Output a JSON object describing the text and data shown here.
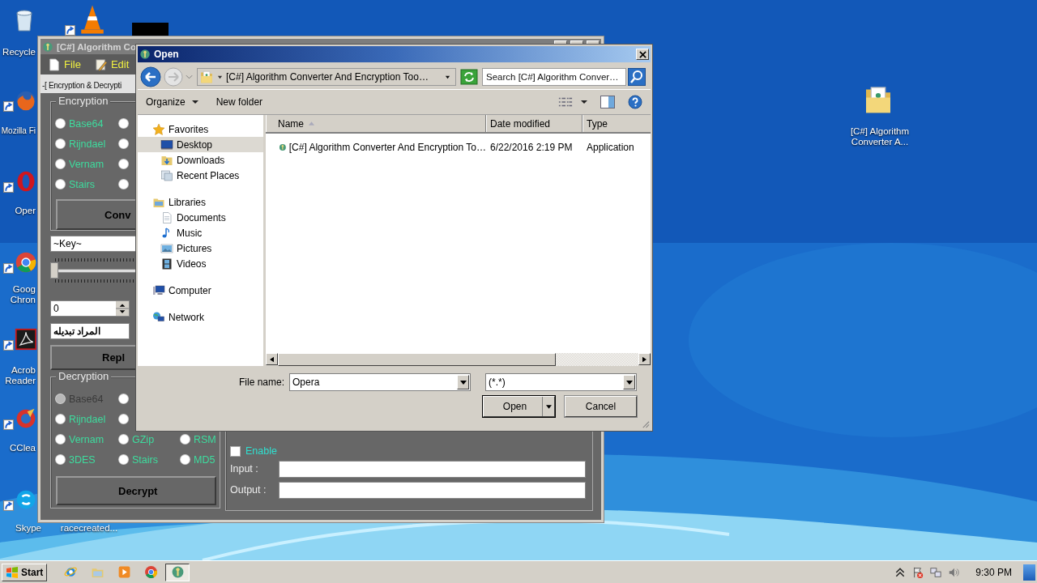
{
  "desktop": {
    "icons": [
      {
        "kind": "recycle-bin",
        "label_lines": [
          "Recycle"
        ],
        "shortcut": false
      },
      {
        "kind": "firefox",
        "label_lines": [
          "Mozilla Fi"
        ],
        "shortcut": true
      },
      {
        "kind": "opera",
        "label_lines": [
          "Oper"
        ],
        "shortcut": true
      },
      {
        "kind": "chrome",
        "label_lines": [
          "Goog",
          "Chron"
        ],
        "shortcut": true
      },
      {
        "kind": "acrobat",
        "label_lines": [
          "Acrob",
          "Reader"
        ],
        "shortcut": true
      },
      {
        "kind": "ccleaner",
        "label_lines": [
          "CClea"
        ],
        "shortcut": true
      },
      {
        "kind": "skype",
        "label_lines": [
          "Skype"
        ],
        "shortcut": true
      },
      {
        "kind": "vlc",
        "shortcut": true
      },
      {
        "kind": "thumbnail",
        "shortcut": false
      },
      {
        "kind": "label-only",
        "label_lines": [
          "racecreated..."
        ],
        "shortcut": false
      },
      {
        "kind": "folder",
        "label_lines": [
          "[C#] Algorithm",
          "Converter A..."
        ],
        "shortcut": false
      }
    ]
  },
  "app_window": {
    "title": "[C#] Algorithm Co",
    "menu": [
      {
        "label": "File",
        "kind": "file"
      },
      {
        "label": "Edit",
        "kind": "edit"
      }
    ],
    "tab": "-[ Encryption & Decrypti",
    "encryption": {
      "title": "Encryption",
      "rows": [
        [
          {
            "label": "Base64",
            "selected": false,
            "disabled": false
          },
          {
            "selected": false,
            "disabled": false
          }
        ],
        [
          {
            "label": "Rijndael",
            "selected": false,
            "disabled": false
          },
          {
            "selected": false,
            "disabled": false
          }
        ],
        [
          {
            "label": "Vernam",
            "selected": false,
            "disabled": false
          },
          {
            "selected": false,
            "disabled": false
          }
        ],
        [
          {
            "label": "Stairs",
            "selected": false,
            "disabled": false
          },
          {
            "selected": false,
            "disabled": false
          }
        ]
      ],
      "button": "Conv"
    },
    "key_field": {
      "value": "~Key~"
    },
    "slider": {
      "level": 0
    },
    "spinner": {
      "value": "0"
    },
    "replace_field": {
      "value": "المراد تبديله"
    },
    "replace_button": "Repl",
    "decryption": {
      "title": "Decryption",
      "rows": [
        [
          {
            "label": "Base64",
            "selected": false,
            "disabled": true
          },
          {
            "selected": false,
            "disabled": false
          }
        ],
        [
          {
            "label": "Rijndael",
            "selected": false,
            "disabled": false
          },
          {
            "selected": false,
            "disabled": false
          }
        ],
        [
          {
            "label": "Vernam",
            "selected": false,
            "disabled": false
          },
          {
            "label": "GZip",
            "selected": false,
            "disabled": false
          },
          {
            "label": "RSM",
            "selected": false,
            "disabled": false
          }
        ],
        [
          {
            "label": "3DES",
            "selected": false,
            "disabled": false
          },
          {
            "label": "Stairs",
            "selected": false,
            "disabled": false
          },
          {
            "label": "MD5",
            "selected": false,
            "disabled": false
          }
        ]
      ],
      "button": "Decrypt"
    },
    "options": {
      "enable": {
        "label": "Enable",
        "checked": false
      },
      "input_label": "Input :",
      "output_label": "Output :"
    }
  },
  "open_dialog": {
    "title": "Open",
    "address": "[C#] Algorithm Converter And Encryption Too…",
    "search": {
      "placeholder": "Search [C#] Algorithm Conver…"
    },
    "toolbar": [
      {
        "label": "Organize",
        "kind": "menu"
      },
      {
        "label": "New folder",
        "kind": "button"
      }
    ],
    "nav": [
      {
        "label": "Favorites",
        "kind": "favorites",
        "selected": false,
        "children": [
          {
            "label": "Desktop",
            "kind": "desktop",
            "selected": true
          },
          {
            "label": "Downloads",
            "kind": "downloads",
            "selected": false
          },
          {
            "label": "Recent Places",
            "kind": "recent",
            "selected": false
          }
        ]
      },
      {
        "label": "Libraries",
        "kind": "libraries",
        "selected": false,
        "children": [
          {
            "label": "Documents",
            "kind": "documents",
            "selected": false
          },
          {
            "label": "Music",
            "kind": "music",
            "selected": false
          },
          {
            "label": "Pictures",
            "kind": "pictures",
            "selected": false
          },
          {
            "label": "Videos",
            "kind": "videos",
            "selected": false
          }
        ]
      },
      {
        "label": "Computer",
        "kind": "computer",
        "selected": false
      },
      {
        "label": "Network",
        "kind": "network",
        "selected": false
      }
    ],
    "columns": [
      {
        "label": "Name",
        "sorted": true
      },
      {
        "label": "Date modified",
        "sorted": false
      },
      {
        "label": "Type",
        "sorted": false
      }
    ],
    "files": [
      {
        "name": "[C#] Algorithm Converter And Encryption To…",
        "date": "6/22/2016 2:19 PM",
        "type": "Application",
        "selected": false
      }
    ],
    "file_name": {
      "label": "File name:",
      "value": "Opera"
    },
    "filter": {
      "value": "(*.*)"
    },
    "buttons": [
      {
        "label": "Open",
        "kind": "split",
        "default": true
      },
      {
        "label": "Cancel",
        "kind": "plain",
        "default": false
      }
    ]
  },
  "taskbar": {
    "start": "Start",
    "tasks": [
      {
        "kind": "ie",
        "active": false
      },
      {
        "kind": "explorer",
        "active": false
      },
      {
        "kind": "media-player",
        "active": false
      },
      {
        "kind": "chrome",
        "active": false
      },
      {
        "kind": "app",
        "active": true
      }
    ],
    "clock": "9:30 PM"
  }
}
